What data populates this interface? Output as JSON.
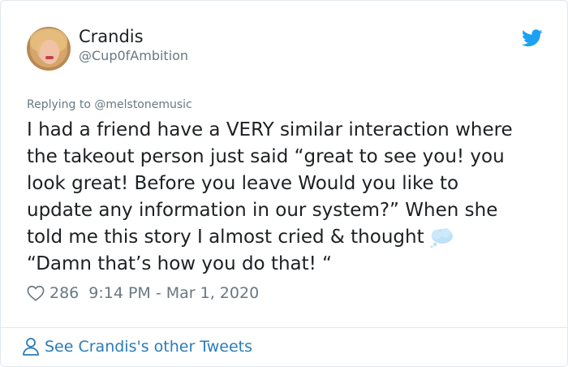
{
  "author": {
    "name": "Crandis",
    "handle": "@Cup0fAmbition"
  },
  "reply_to": "Replying to @melstonemusic",
  "tweet": {
    "lines": [
      "I had a friend have a VERY similar interaction where",
      "the takeout person just said “great to see you! you",
      "look great! Before you leave Would you like to",
      "update any information in our system?”  When she",
      "told me this story I almost cried & thought",
      "“Damn that’s how you do that! “"
    ]
  },
  "meta": {
    "likes": "286",
    "timestamp": "9:14 PM - Mar 1, 2020"
  },
  "footer": {
    "label": "See Crandis's other Tweets"
  },
  "colors": {
    "link": "#2b7bb9",
    "twitter_blue": "#1da1f2",
    "muted": "#697882",
    "border": "#e1e8ed"
  },
  "icons": {
    "brand": "twitter-bird-icon",
    "like": "heart-icon",
    "thought": "thought-balloon-icon",
    "profile": "person-icon"
  }
}
